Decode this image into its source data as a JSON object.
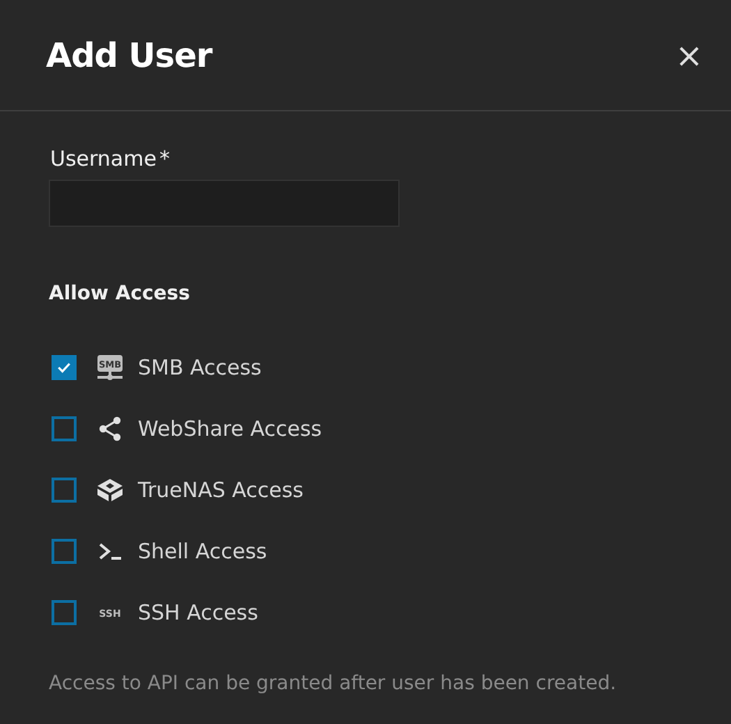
{
  "dialog": {
    "title": "Add User",
    "close": "×"
  },
  "username": {
    "label": "Username",
    "required_mark": "*"
  },
  "section": "Allow Access",
  "access": [
    {
      "kind": "smb",
      "label": "SMB Access",
      "icon_text": "SMB",
      "checked": true
    },
    {
      "kind": "share",
      "label": "WebShare Access",
      "checked": false
    },
    {
      "kind": "truenas",
      "label": "TrueNAS Access",
      "checked": false
    },
    {
      "kind": "shell",
      "label": "Shell Access",
      "checked": false
    },
    {
      "kind": "ssh",
      "label": "SSH Access",
      "icon_text": "SSH",
      "checked": false
    }
  ],
  "note": "Access to API can be granted after user has been created."
}
